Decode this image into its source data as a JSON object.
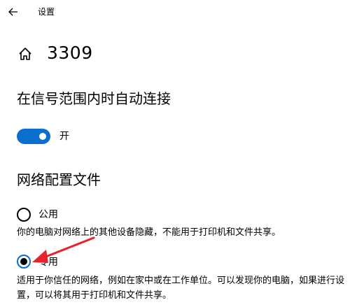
{
  "window": {
    "title": "设置",
    "back_icon": "arrow-left-icon"
  },
  "page": {
    "icon": "home-icon",
    "title": "3309"
  },
  "auto_connect": {
    "heading": "在信号范围内时自动连接",
    "toggle_state": "on",
    "toggle_label": "开",
    "accent_color": "#0b6fd0"
  },
  "network_profile": {
    "heading": "网络配置文件",
    "selected": "private",
    "options": [
      {
        "id": "public",
        "label": "公用",
        "description": "你的电脑对网络上的其他设备隐藏，不能用于打印机和文件共享。"
      },
      {
        "id": "private",
        "label": "专用",
        "description": "适用于你信任的网络，例如在家中或在工作单位。可以发现你的电脑，如果进行设置，可以将其用于打印机和文件共享。"
      }
    ]
  },
  "annotation": {
    "type": "arrow",
    "color": "#e8212b",
    "points_to": "private-radio"
  }
}
